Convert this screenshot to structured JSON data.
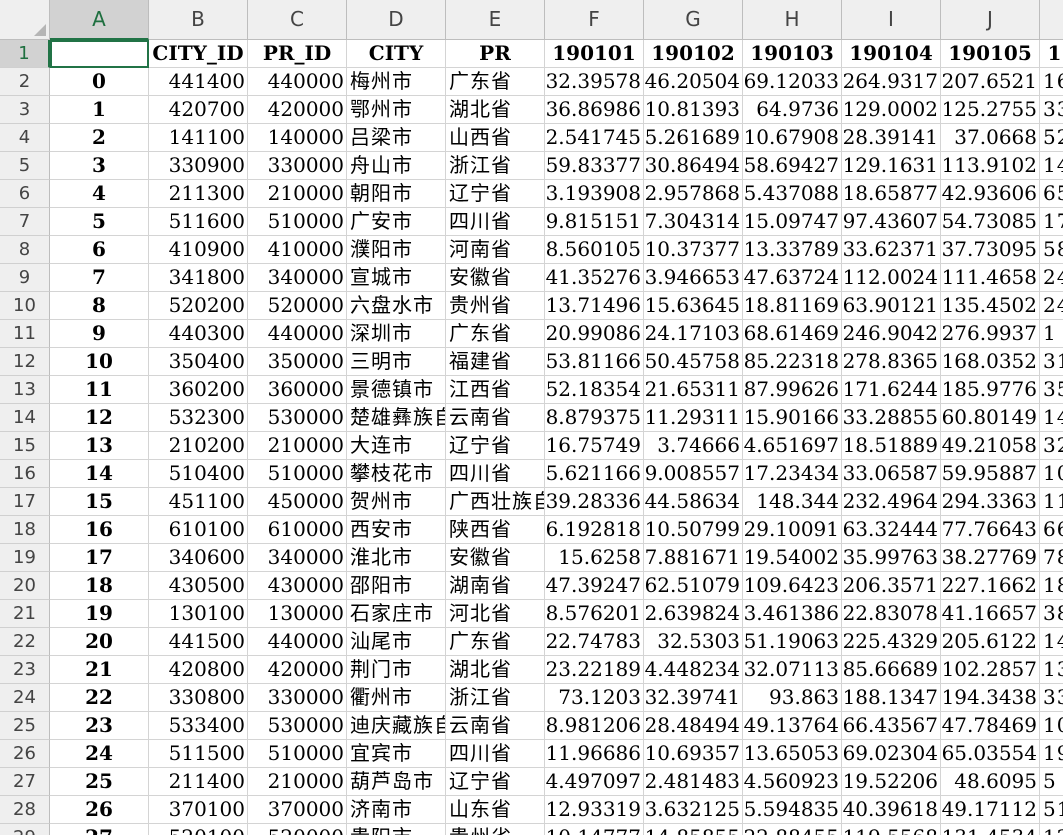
{
  "columns": [
    "A",
    "B",
    "C",
    "D",
    "E",
    "F",
    "G",
    "H",
    "I",
    "J",
    ""
  ],
  "header_row": {
    "num": "1",
    "cells": [
      "",
      "CITY_ID",
      "PR_ID",
      "CITY",
      "PR",
      "190101",
      "190102",
      "190103",
      "190104",
      "190105",
      "1"
    ]
  },
  "rows": [
    {
      "num": "2",
      "cells": [
        "0",
        "441400",
        "440000",
        "梅州市",
        "广东省",
        "32.39578",
        "46.20504",
        "69.12033",
        "264.9317",
        "207.6521",
        "16"
      ]
    },
    {
      "num": "3",
      "cells": [
        "1",
        "420700",
        "420000",
        "鄂州市",
        "湖北省",
        "36.86986",
        "10.81393",
        "64.9736",
        "129.0002",
        "125.2755",
        "33"
      ]
    },
    {
      "num": "4",
      "cells": [
        "2",
        "141100",
        "140000",
        "吕梁市",
        "山西省",
        "2.541745",
        "5.261689",
        "10.67908",
        "28.39141",
        "37.0668",
        "52"
      ]
    },
    {
      "num": "5",
      "cells": [
        "3",
        "330900",
        "330000",
        "舟山市",
        "浙江省",
        "59.83377",
        "30.86494",
        "58.69427",
        "129.1631",
        "113.9102",
        "14"
      ]
    },
    {
      "num": "6",
      "cells": [
        "4",
        "211300",
        "210000",
        "朝阳市",
        "辽宁省",
        "3.193908",
        "2.957868",
        "5.437088",
        "18.65877",
        "42.93606",
        "65"
      ]
    },
    {
      "num": "7",
      "cells": [
        "5",
        "511600",
        "510000",
        "广安市",
        "四川省",
        "9.815151",
        "7.304314",
        "15.09747",
        "97.43607",
        "54.73085",
        "17"
      ]
    },
    {
      "num": "8",
      "cells": [
        "6",
        "410900",
        "410000",
        "濮阳市",
        "河南省",
        "8.560105",
        "10.37377",
        "13.33789",
        "33.62371",
        "37.73095",
        "58"
      ]
    },
    {
      "num": "9",
      "cells": [
        "7",
        "341800",
        "340000",
        "宣城市",
        "安徽省",
        "41.35276",
        "3.946653",
        "47.63724",
        "112.0024",
        "111.4658",
        "24"
      ]
    },
    {
      "num": "10",
      "cells": [
        "8",
        "520200",
        "520000",
        "六盘水市",
        "贵州省",
        "13.71496",
        "15.63645",
        "18.81169",
        "63.90121",
        "135.4502",
        "24"
      ]
    },
    {
      "num": "11",
      "cells": [
        "9",
        "440300",
        "440000",
        "深圳市",
        "广东省",
        "20.99086",
        "24.17103",
        "68.61469",
        "246.9042",
        "276.9937",
        "1"
      ]
    },
    {
      "num": "12",
      "cells": [
        "10",
        "350400",
        "350000",
        "三明市",
        "福建省",
        "53.81166",
        "50.45758",
        "85.22318",
        "278.8365",
        "168.0352",
        "31"
      ]
    },
    {
      "num": "13",
      "cells": [
        "11",
        "360200",
        "360000",
        "景德镇市",
        "江西省",
        "52.18354",
        "21.65311",
        "87.99626",
        "171.6244",
        "185.9776",
        "35"
      ]
    },
    {
      "num": "14",
      "cells": [
        "12",
        "532300",
        "530000",
        "楚雄彝族自",
        "云南省",
        "8.879375",
        "11.29311",
        "15.90166",
        "33.28855",
        "60.80149",
        "14"
      ]
    },
    {
      "num": "15",
      "cells": [
        "13",
        "210200",
        "210000",
        "大连市",
        "辽宁省",
        "16.75749",
        "3.74666",
        "4.651697",
        "18.51889",
        "49.21058",
        "32"
      ]
    },
    {
      "num": "16",
      "cells": [
        "14",
        "510400",
        "510000",
        "攀枝花市",
        "四川省",
        "5.621166",
        "9.008557",
        "17.23434",
        "33.06587",
        "59.95887",
        "10"
      ]
    },
    {
      "num": "17",
      "cells": [
        "15",
        "451100",
        "450000",
        "贺州市",
        "广西壮族自",
        "39.28336",
        "44.58634",
        "148.344",
        "232.4964",
        "294.3363",
        "11"
      ]
    },
    {
      "num": "18",
      "cells": [
        "16",
        "610100",
        "610000",
        "西安市",
        "陕西省",
        "6.192818",
        "10.50799",
        "29.10091",
        "63.32444",
        "77.76643",
        "66"
      ]
    },
    {
      "num": "19",
      "cells": [
        "17",
        "340600",
        "340000",
        "淮北市",
        "安徽省",
        "15.6258",
        "7.881671",
        "19.54002",
        "35.99763",
        "38.27769",
        "78"
      ]
    },
    {
      "num": "20",
      "cells": [
        "18",
        "430500",
        "430000",
        "邵阳市",
        "湖南省",
        "47.39247",
        "62.51079",
        "109.6423",
        "206.3571",
        "227.1662",
        "18"
      ]
    },
    {
      "num": "21",
      "cells": [
        "19",
        "130100",
        "130000",
        "石家庄市",
        "河北省",
        "8.576201",
        "2.639824",
        "3.461386",
        "22.83078",
        "41.16657",
        "38"
      ]
    },
    {
      "num": "22",
      "cells": [
        "20",
        "441500",
        "440000",
        "汕尾市",
        "广东省",
        "22.74783",
        "32.5303",
        "51.19063",
        "225.4329",
        "205.6122",
        "14"
      ]
    },
    {
      "num": "23",
      "cells": [
        "21",
        "420800",
        "420000",
        "荆门市",
        "湖北省",
        "23.22189",
        "4.448234",
        "32.07113",
        "85.66689",
        "102.2857",
        "13"
      ]
    },
    {
      "num": "24",
      "cells": [
        "22",
        "330800",
        "330000",
        "衢州市",
        "浙江省",
        "73.1203",
        "32.39741",
        "93.863",
        "188.1347",
        "194.3438",
        "33"
      ]
    },
    {
      "num": "25",
      "cells": [
        "23",
        "533400",
        "530000",
        "迪庆藏族自",
        "云南省",
        "8.981206",
        "28.48494",
        "49.13764",
        "66.43567",
        "47.78469",
        "10"
      ]
    },
    {
      "num": "26",
      "cells": [
        "24",
        "511500",
        "510000",
        "宜宾市",
        "四川省",
        "11.96686",
        "10.69357",
        "13.65053",
        "69.02304",
        "65.03554",
        "19"
      ]
    },
    {
      "num": "27",
      "cells": [
        "25",
        "211400",
        "210000",
        "葫芦岛市",
        "辽宁省",
        "4.497097",
        "2.481483",
        "4.560923",
        "19.52206",
        "48.6095",
        "5"
      ]
    },
    {
      "num": "28",
      "cells": [
        "26",
        "370100",
        "370000",
        "济南市",
        "山东省",
        "12.93319",
        "3.632125",
        "5.594835",
        "40.39618",
        "49.17112",
        "51"
      ]
    },
    {
      "num": "29",
      "cells": [
        "27",
        "520100",
        "520000",
        "贵阳市",
        "贵州省",
        "10.14777",
        "14.85855",
        "22.88455",
        "119.5568",
        "131.4534",
        "12"
      ]
    }
  ]
}
